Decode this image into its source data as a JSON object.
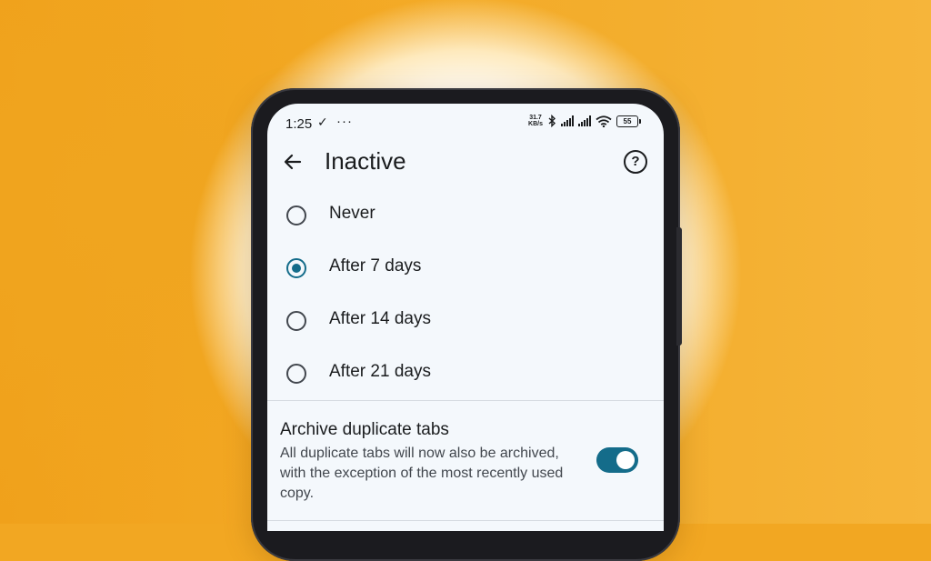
{
  "status_bar": {
    "time": "1:25",
    "net_speed_value": "31.7",
    "net_speed_unit": "KB/s",
    "battery": "55"
  },
  "app_bar": {
    "title": "Inactive"
  },
  "options": [
    {
      "label": "Never",
      "selected": false
    },
    {
      "label": "After 7 days",
      "selected": true
    },
    {
      "label": "After 14 days",
      "selected": false
    },
    {
      "label": "After 21 days",
      "selected": false
    }
  ],
  "archive_duplicates": {
    "title": "Archive duplicate tabs",
    "description": "All duplicate tabs will now also be archived, with the exception of the most recently used copy.",
    "enabled": true
  },
  "colors": {
    "accent": "#146c8a",
    "background_orange": "#f2a722",
    "screen_bg": "#f4f8fc"
  }
}
